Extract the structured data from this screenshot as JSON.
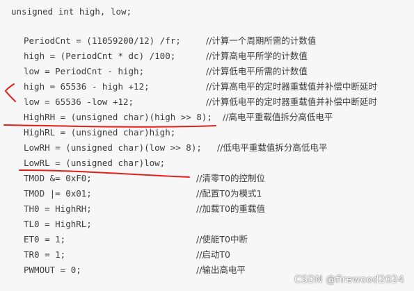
{
  "code": {
    "declaration": "unsigned int high, low;",
    "lines": [
      {
        "code": "PeriodCnt = (11059200/12) /fr;",
        "comment": "//计算一个周期所需的计数值"
      },
      {
        "code": "high = (PeriodCnt * dc) /100;",
        "comment": "//计算高电平所学的计数值"
      },
      {
        "code": "low = PeriodCnt - high;",
        "comment": "//计算低电平所需的计数值"
      },
      {
        "code": "high = 65536 - high +12;",
        "comment": "//计算高电平的定时器重载值并补偿中断延时"
      },
      {
        "code": "low = 65536 -low +12;",
        "comment": "//计算低电平的定时器重载值并补偿中断延时"
      },
      {
        "code": "HighRH = (unsigned char)(high >> 8);",
        "comment": "//高电平重载值拆分高低电平"
      },
      {
        "code": "HighRL = (unsigned char)high;",
        "comment": ""
      },
      {
        "code": "LowRH = (unsigned char)(low >> 8);",
        "comment": "//低电平重载值拆分高低电平"
      },
      {
        "code": "LowRL = (unsigned char)low;",
        "comment": ""
      },
      {
        "code": "TMOD &= 0xF0;",
        "comment": "//清零T0的控制位"
      },
      {
        "code": "TMOD |= 0x01;",
        "comment": "//配置T0为模式1"
      },
      {
        "code": "TH0 = HighRH;",
        "comment": "//加载T0的重载值"
      },
      {
        "code": "TL0 = HighRL;",
        "comment": ""
      },
      {
        "code": "ET0 = 1;",
        "comment": "//使能T0中断"
      },
      {
        "code": "TR0 = 1;",
        "comment": "//启动T0"
      },
      {
        "code": "PWMOUT = 0;",
        "comment": "//输出高电平"
      }
    ]
  },
  "watermark": "CSDN @firewood2024",
  "colors": {
    "annotation": "#e0201a",
    "background": "#f7f7f8",
    "text": "#3b3b3b"
  }
}
